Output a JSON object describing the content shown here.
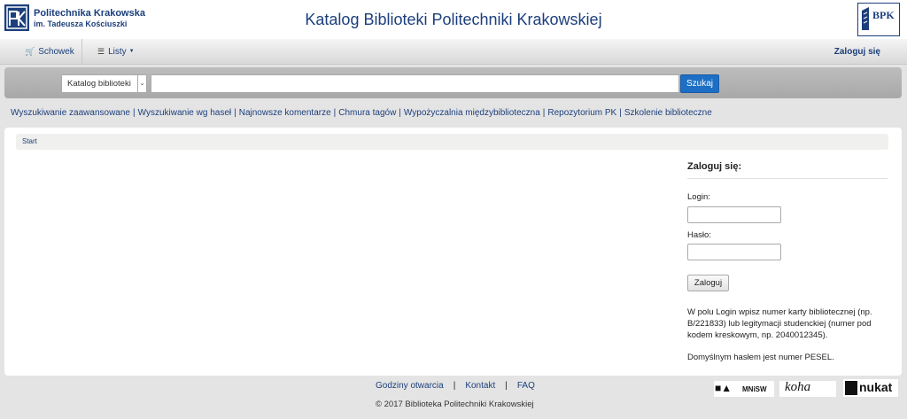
{
  "header": {
    "institution_line1": "Politechnika Krakowska",
    "institution_line2": "im. Tadeusza Kościuszki",
    "site_title": "Katalog Biblioteki Politechniki Krakowskiej",
    "bpk_logo_text": "BPK"
  },
  "topnav": {
    "schowek_label": "Schowek",
    "listy_label": "Listy",
    "login_label": "Zaloguj się"
  },
  "search": {
    "scope_selected": "Katalog biblioteki",
    "query_value": "",
    "button_label": "Szukaj"
  },
  "links": [
    "Wyszukiwanie zaawansowane",
    "Wyszukiwanie wg haseł",
    "Najnowsze komentarze",
    "Chmura tagów",
    "Wypożyczalnia międzybiblioteczna",
    "Repozytorium PK",
    "Szkolenie biblioteczne"
  ],
  "breadcrumb": {
    "start": "Start"
  },
  "login": {
    "title": "Zaloguj się:",
    "login_label": "Login:",
    "password_label": "Hasło:",
    "button_label": "Zaloguj",
    "help_text": "W polu Login wpisz numer karty bibliotecznej (np. B/221833) lub legitymacji studenckiej (numer pod kodem kreskowym, np. 2040012345).",
    "default_password_text": "Domyślnym hasłem jest numer PESEL."
  },
  "footer": {
    "links": [
      "Godziny otwarcia",
      "Kontakt",
      "FAQ"
    ],
    "copyright": "© 2017 Biblioteka Politechniki Krakowskiej",
    "logo_mnisw_text": "MNiSW",
    "logo_koha_text": "koha",
    "logo_nukat_text": "nukat"
  },
  "colors": {
    "brand_blue": "#1c3f7c",
    "button_blue": "#1c6fc4",
    "page_background": "#e4e4e4"
  },
  "icons": {
    "schowek": "cart-icon",
    "listy": "list-icon",
    "listy_caret": "chevron-down-icon"
  }
}
